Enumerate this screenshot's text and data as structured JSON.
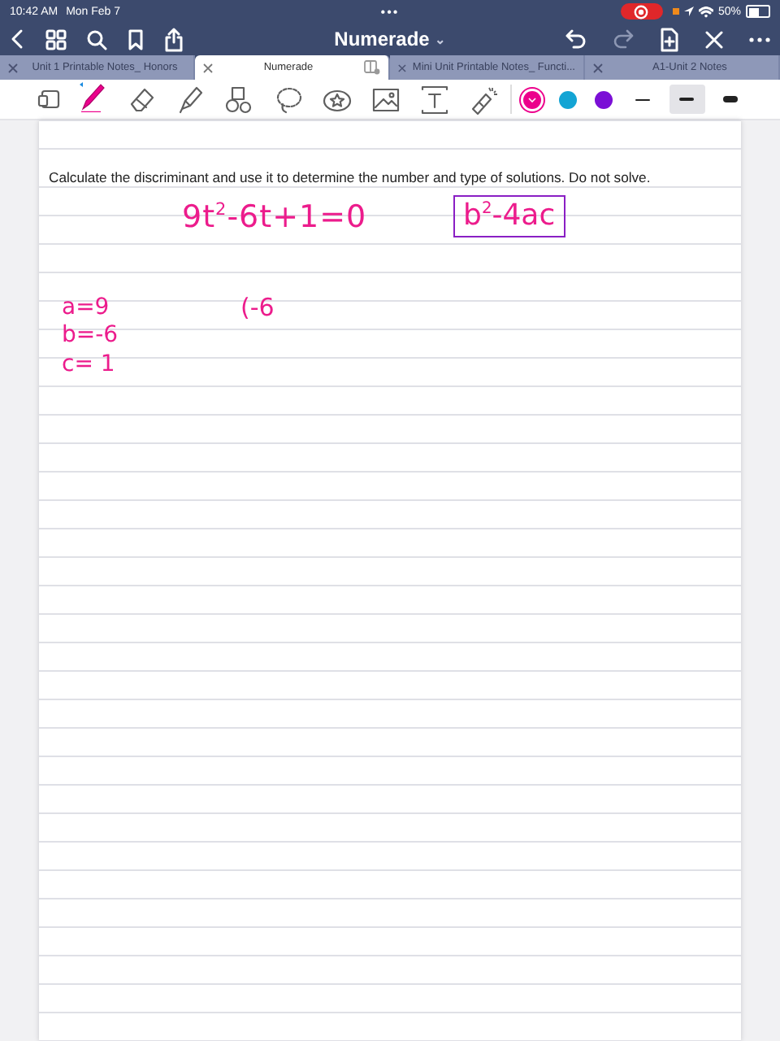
{
  "status_bar": {
    "time": "10:42 AM",
    "date": "Mon Feb 7",
    "dots": "•••",
    "recording": true,
    "battery_text": "50%",
    "battery": {
      "level": 0.5
    }
  },
  "nav_bar": {
    "title": "Numerade",
    "caret": "⌄"
  },
  "tabs": [
    {
      "label": "Unit 1 Printable Notes_ Honors",
      "selected": false
    },
    {
      "label": "Numerade",
      "selected": true
    },
    {
      "label": "Mini Unit  Printable Notes_ Functi...",
      "selected": false
    },
    {
      "label": "A1-Unit 2 Notes",
      "selected": false
    }
  ],
  "toolbar": {
    "tools": [
      {
        "kind": "pen",
        "selected": true
      },
      {
        "kind": "eraser",
        "selected": false
      },
      {
        "kind": "highlighter",
        "selected": false
      },
      {
        "kind": "shapes",
        "selected": false
      },
      {
        "kind": "lasso",
        "selected": false
      },
      {
        "kind": "sticker",
        "selected": false
      },
      {
        "kind": "image",
        "selected": false
      },
      {
        "kind": "text",
        "selected": false
      },
      {
        "kind": "laser",
        "selected": false
      }
    ],
    "colors": [
      {
        "color": "#ec008c",
        "selected": true
      },
      {
        "color": "#13a4d4",
        "selected": false
      },
      {
        "color": "#7b0fd6",
        "selected": false
      }
    ],
    "strokes": [
      {
        "selected": false
      },
      {
        "selected": true
      },
      {
        "selected": false
      }
    ]
  },
  "page": {
    "question": "Calculate the discriminant and use it to determine the number and type of solutions. Do not solve.",
    "handwriting": [
      {
        "text": "9t$^{2}$-6t+1=0",
        "kind": "equation",
        "color": "#ec1c8c"
      },
      {
        "text": "b$^{2}$-4ac",
        "kind": "boxed",
        "color": "#ec1c8c"
      },
      {
        "text": "a=9",
        "kind": "a",
        "color": "#ec1c8c"
      },
      {
        "text": "b=-6",
        "kind": "b",
        "color": "#ec1c8c"
      },
      {
        "text": "c= 1",
        "kind": "c",
        "color": "#ec1c8c"
      },
      {
        "text": "(-6",
        "kind": "work",
        "color": "#ec1c8c"
      }
    ]
  }
}
